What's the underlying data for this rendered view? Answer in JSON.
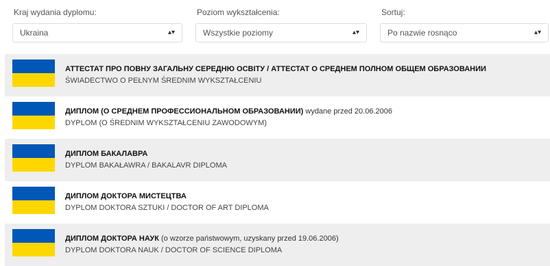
{
  "filters": {
    "country": {
      "label": "Kraj wydania dyplomu:",
      "value": "Ukraina"
    },
    "level": {
      "label": "Poziom wykształcenia:",
      "value": "Wszystkie poziomy"
    },
    "sort": {
      "label": "Sortuj:",
      "value": "Po nazwie rosnąco"
    },
    "arrow_icon": "updown-arrow-icon"
  },
  "flag_colors": {
    "top": "#0057b7",
    "bottom": "#ffd700"
  },
  "items": [
    {
      "title": "АТТЕСТАТ ПРО ПОВНУ ЗАГАЛЬНУ СЕРЕДНЮ ОСВІТУ / АТТЕСТАТ О СРЕДНЕМ ПОЛНОМ ОБЩЕМ ОБРАЗОВАНИИ",
      "note": "",
      "subtitle": "ŚWIADECTWO O PEŁNYM ŚREDNIM WYKSZTAŁCENIU"
    },
    {
      "title": "ДИПЛОМ (О СРЕДНЕМ ПРОФЕССИОНАЛЬНОМ ОБРАЗОВАНИИ)",
      "note": " wydane przed 20.06.2006",
      "subtitle": "DYPLOM (O ŚREDNIM WYKSZTAŁCENIU ZAWODOWYM)"
    },
    {
      "title": "ДИПЛОМ БАКАЛАВРА",
      "note": "",
      "subtitle": "DYPLOM BAKAŁAWRA / BAKALAVR DIPLOMA"
    },
    {
      "title": "ДИПЛОМ ДОКТОРА МИСТЕЦТВА",
      "note": "",
      "subtitle": "DYPLOM DOKTORA SZTUKI / DOCTOR OF ART DIPLOMA"
    },
    {
      "title": "ДИПЛОМ ДОКТОРА НАУК",
      "note": " (o wzorze państwowym, uzyskany przed 19.06.2006)",
      "subtitle": "DYPLOM DOKTORA NAUK / DOCTOR OF SCIENCE DIPLOMA"
    }
  ]
}
